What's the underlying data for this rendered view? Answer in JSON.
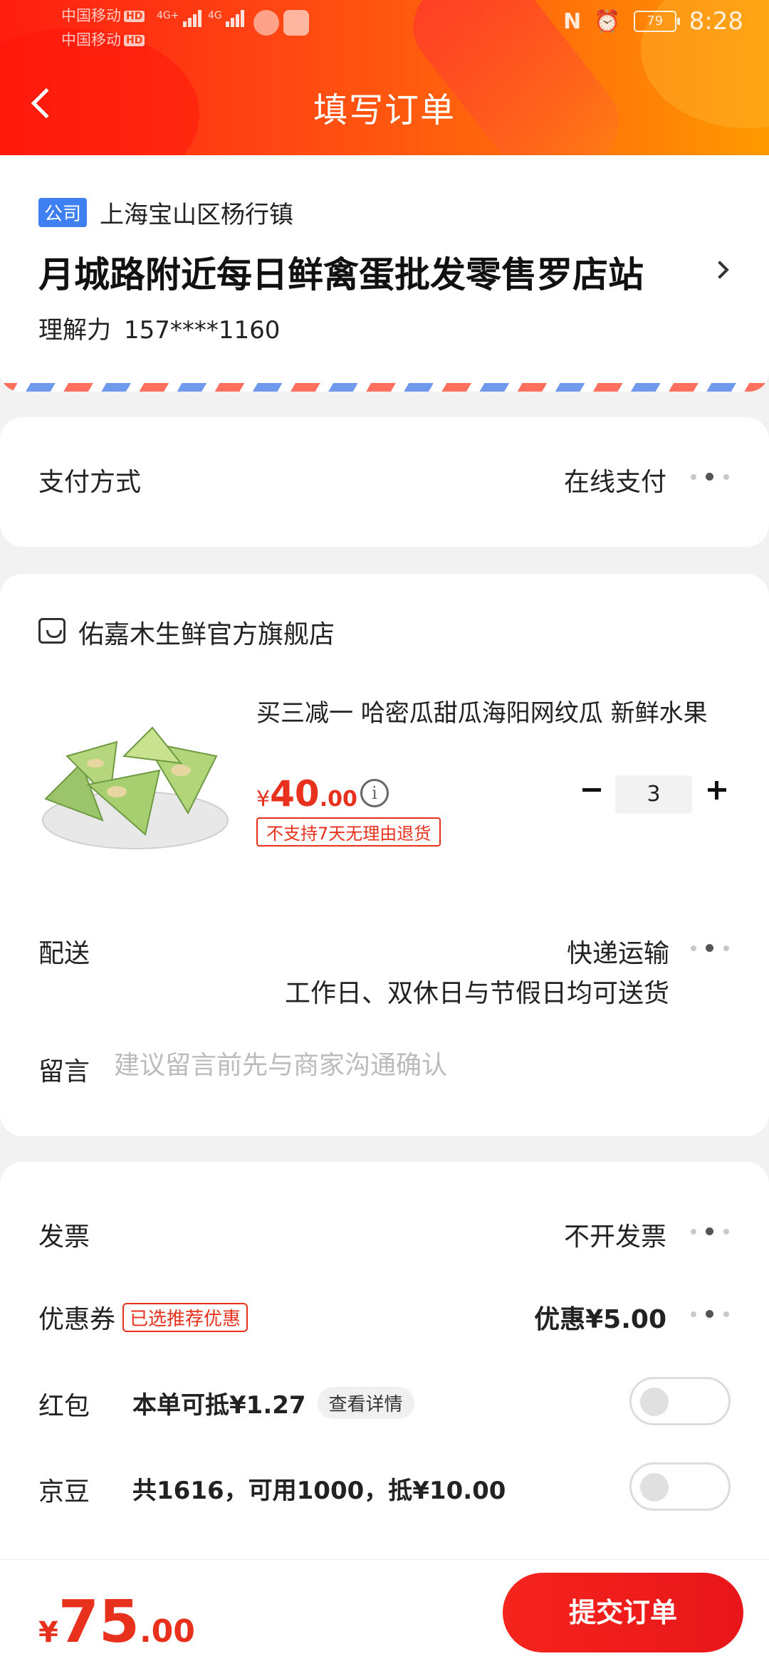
{
  "status_bar": {
    "carrier1": "中国移动",
    "carrier2": "中国移动",
    "hd": "HD",
    "net1": "4G+",
    "net2": "4G",
    "battery": "79",
    "time": "8:28",
    "icons": [
      "nfc-icon",
      "alarm-icon"
    ]
  },
  "header": {
    "title": "填写订单",
    "back_icon": "chevron-left-icon"
  },
  "address": {
    "tag": "公司",
    "region": "上海宝山区杨行镇",
    "detail": "月城路附近每日鲜禽蛋批发零售罗店站",
    "name": "理解力",
    "phone": "157****1160"
  },
  "payment": {
    "label": "支付方式",
    "value": "在线支付"
  },
  "shop": {
    "name": "佑嘉木生鲜官方旗舰店",
    "product": {
      "title": "买三减一  哈密瓜甜瓜海阳网纹瓜 新鲜水果",
      "price_symbol": "¥",
      "price_int": "40",
      "price_dec": ".00",
      "no_return_tag": "不支持7天无理由退货",
      "quantity": "3"
    },
    "delivery": {
      "label": "配送",
      "value": "快递运输",
      "note": "工作日、双休日与节假日均可送货"
    },
    "message": {
      "label": "留言",
      "placeholder": "建议留言前先与商家沟通确认"
    }
  },
  "billing": {
    "invoice": {
      "label": "发票",
      "value": "不开发票"
    },
    "coupon": {
      "label": "优惠券",
      "tag": "已选推荐优惠",
      "value": "优惠¥5.00"
    },
    "redpacket": {
      "label": "红包",
      "text": "本单可抵¥1.27",
      "detail": "查看详情"
    },
    "jingdou": {
      "label": "京豆",
      "text": "共1616，可用1000，抵¥10.00"
    }
  },
  "footer": {
    "total_symbol": "¥",
    "total_int": "75",
    "total_dec": ".00",
    "submit": "提交订单"
  },
  "colors": {
    "accent": "#e8311d",
    "header_start": "#ff1e10",
    "header_end": "#ff9a00",
    "company_tag": "#3e80f2"
  }
}
